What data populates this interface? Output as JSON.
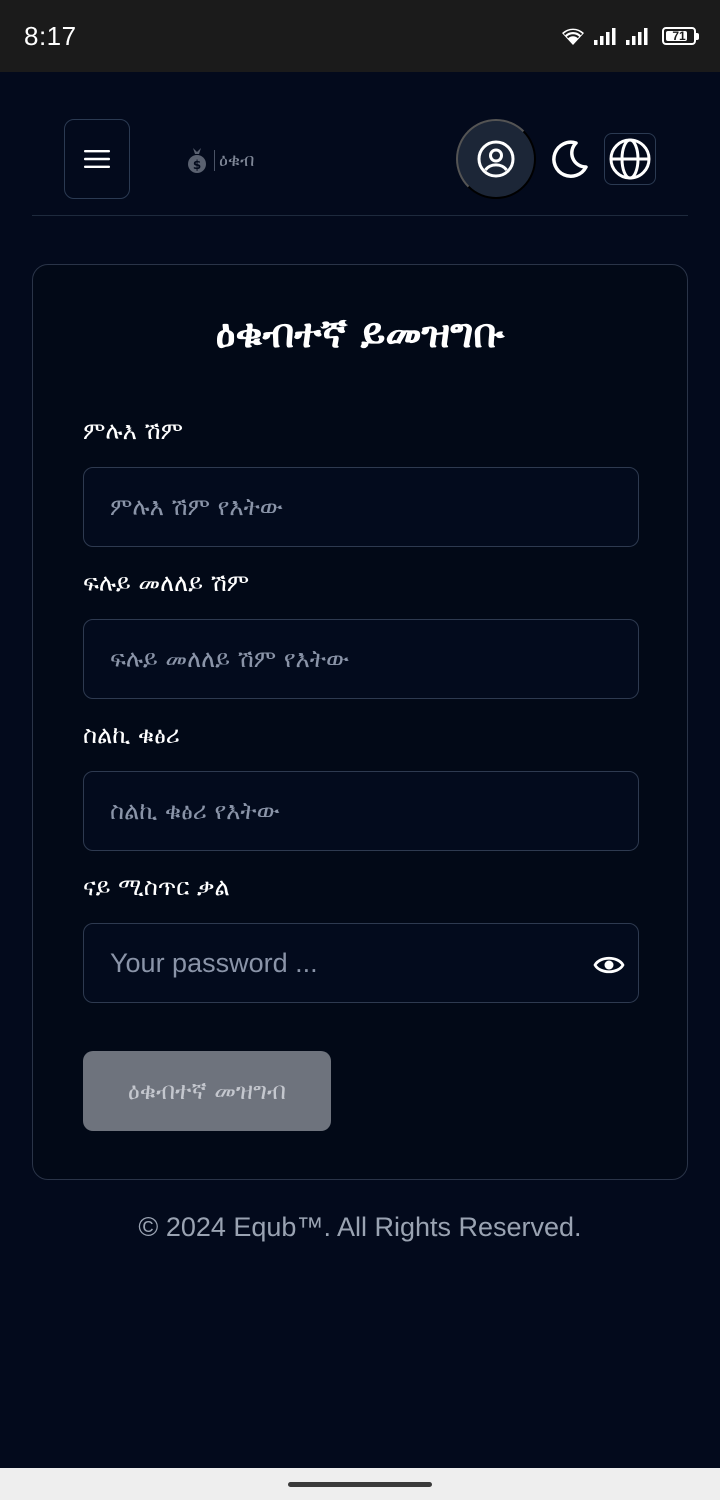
{
  "status_bar": {
    "time": "8:17",
    "battery": "71",
    "battery_level": 0.71
  },
  "header": {
    "brand_name": "ዕቁብ",
    "icons": {
      "menu": "hamburger-menu-icon",
      "logo": "money-bag-icon",
      "profile": "user-circle-icon",
      "theme": "moon-icon",
      "language": "globe-icon"
    }
  },
  "form": {
    "title": "ዕቁብተኛ ይመዝግቡ",
    "full_name": {
      "label": "ምሉእ ሽም",
      "placeholder": "ምሉእ ሽም የእትው"
    },
    "username": {
      "label": "ፍሉይ መለለይ ሽም",
      "placeholder": "ፍሉይ መለለይ ሽም የእትው"
    },
    "phone": {
      "label": "ስልኪ ቁፅሪ",
      "placeholder": "ስልኪ ቁፅሪ የእትው"
    },
    "password": {
      "label": "ናይ ሚስጥር ቃል",
      "placeholder": "Your password ...",
      "toggle_icon": "eye-icon"
    },
    "submit_label": "ዕቁብተኛ መዝግብ"
  },
  "footer": {
    "copyright": "© 2024 Equb™. All Rights Reserved."
  },
  "colors": {
    "background": "#030a1c",
    "card_border": "#2a3448",
    "button_disabled": "#6e737d",
    "profile_bg": "#1c2637"
  }
}
